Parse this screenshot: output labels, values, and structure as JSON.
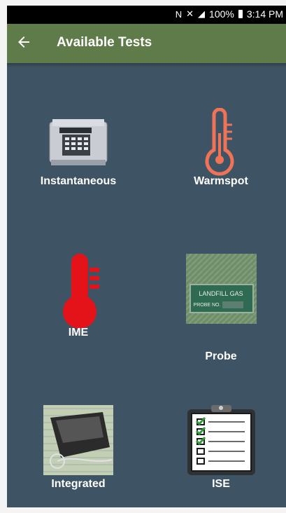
{
  "status_bar": {
    "battery": "100%",
    "time": "3:14 PM"
  },
  "app_bar": {
    "title": "Available Tests",
    "back_icon": "arrow-left-icon"
  },
  "tests": [
    {
      "label": "Instantaneous",
      "icon": "gas-monitor-device-icon"
    },
    {
      "label": "Warmspot",
      "icon": "thermometer-outline-icon",
      "color": "#f07358"
    },
    {
      "label": "IME",
      "icon": "thermometer-filled-icon",
      "color": "#e4131a"
    },
    {
      "label": "Probe",
      "icon": "landfill-gas-probe-photo"
    },
    {
      "label": "Integrated",
      "icon": "integrated-sampler-photo"
    },
    {
      "label": "ISE",
      "icon": "checklist-clipboard-icon"
    }
  ],
  "photo_text": {
    "probe_plate_line1": "LANDFILL GAS",
    "probe_plate_line2": "PROBE NO."
  }
}
